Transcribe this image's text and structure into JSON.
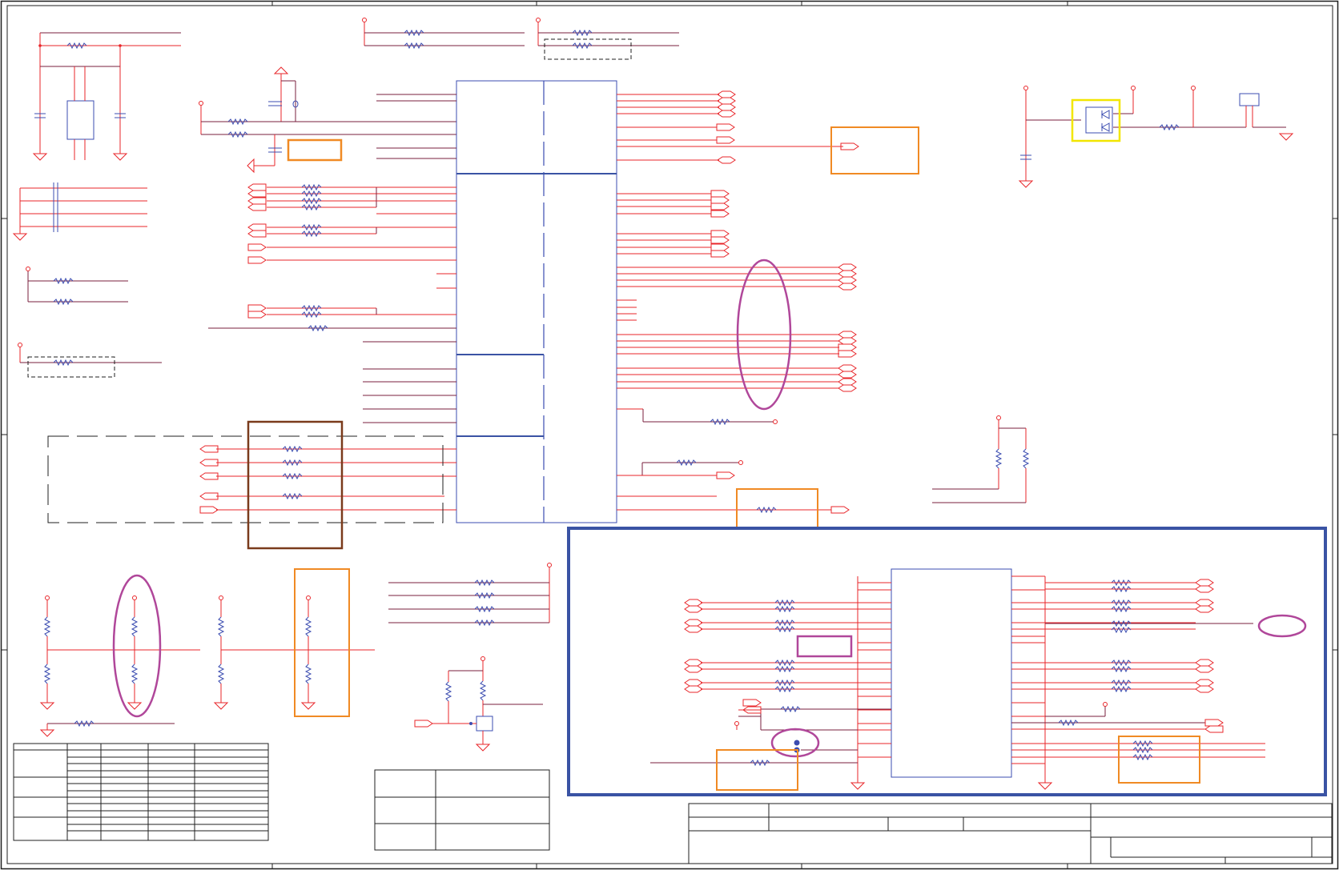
{
  "sheet": {
    "type": "schematic",
    "colors": {
      "paper": "#ffffff",
      "border": "#1f1f1f",
      "net": "#e8262a",
      "wire_alt": "#7a1f3d",
      "ic_outline": "#3b4cb0",
      "component": "#3b4cb0",
      "annot_orange": "#f08a24",
      "annot_purple": "#b0479a",
      "annot_blue": "#3a53a4",
      "annot_brown": "#7a3b1c",
      "annot_yellow": "#f2e600"
    },
    "annotations": [
      {
        "name": "annot-box-top-mid",
        "color": "annot_orange"
      },
      {
        "name": "annot-box-net-right",
        "color": "annot_orange"
      },
      {
        "name": "annot-ellipse-bus",
        "color": "annot_purple"
      },
      {
        "name": "annot-box-series-res",
        "color": "annot_brown"
      },
      {
        "name": "annot-box-bottom-res",
        "color": "annot_orange"
      },
      {
        "name": "annot-highlight-subsheet",
        "color": "annot_blue"
      },
      {
        "name": "annot-box-diode",
        "color": "annot_yellow"
      },
      {
        "name": "annot-ellipse-pullups",
        "color": "annot_purple"
      },
      {
        "name": "annot-box-pullups",
        "color": "annot_orange"
      }
    ]
  }
}
